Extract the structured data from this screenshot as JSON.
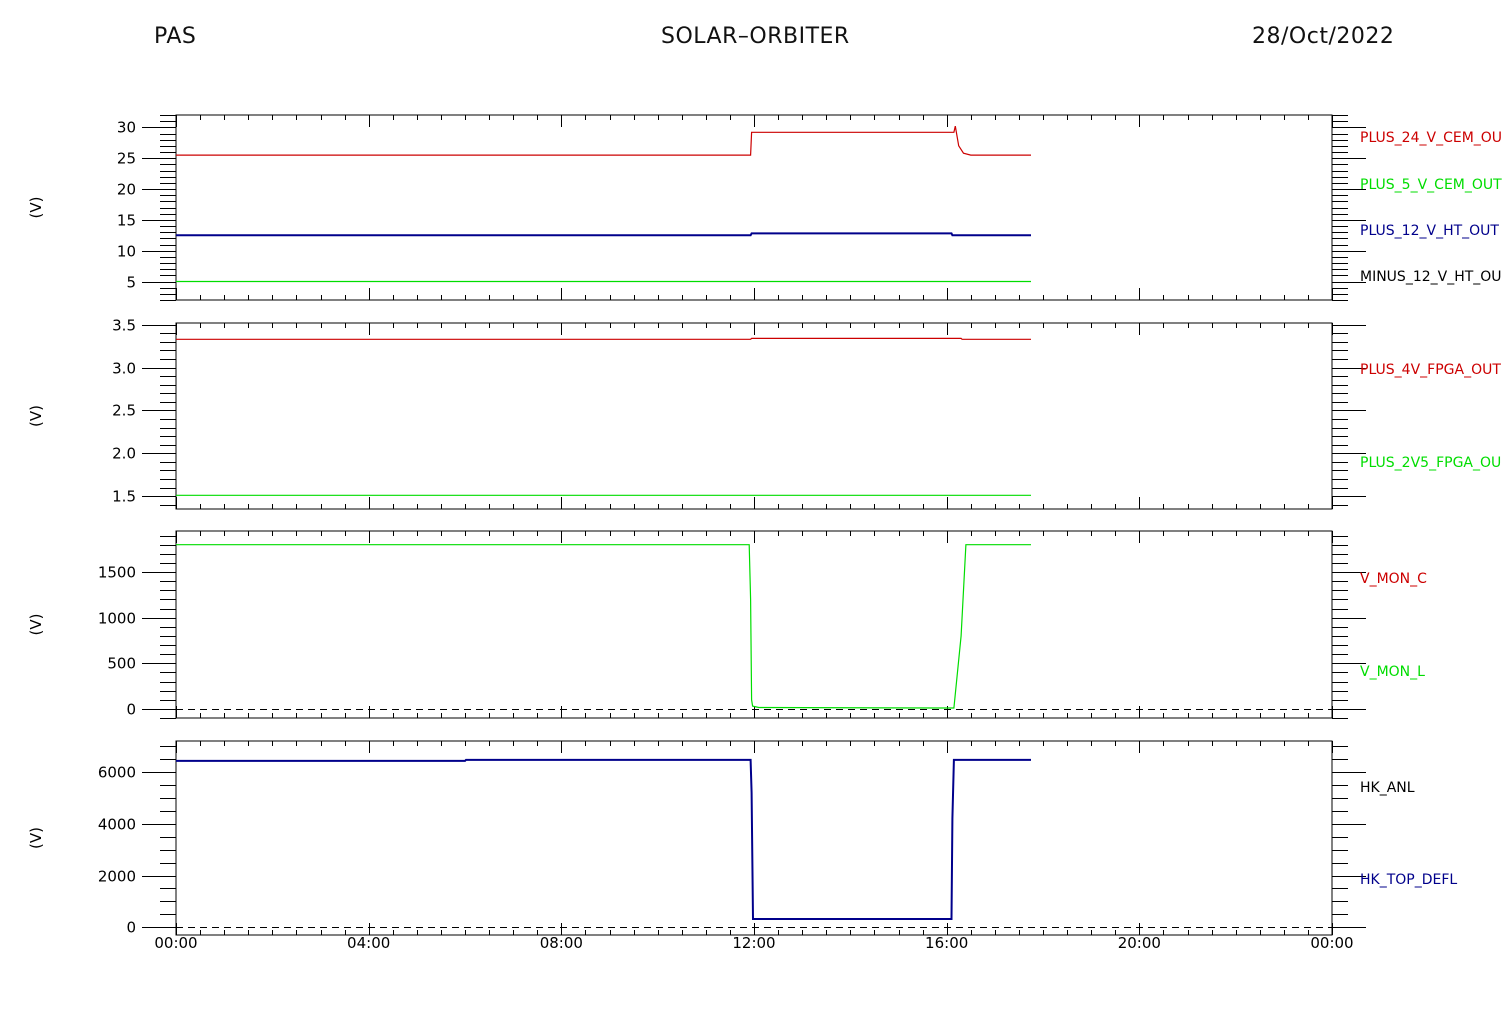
{
  "header": {
    "left": "PAS",
    "center": "SOLAR–ORBITER",
    "right": "28/Oct/2022"
  },
  "colors": {
    "red": "#cc0000",
    "green": "#00dd00",
    "blue": "#00008b",
    "black": "#000000",
    "axis": "#000000"
  },
  "chart_data": [
    {
      "type": "line",
      "ylabel": "(V)",
      "ylim": [
        2,
        32
      ],
      "yticks": [
        5,
        10,
        15,
        20,
        25,
        30
      ],
      "ytick_labels": [
        "5",
        "10",
        "15",
        "20",
        "25",
        "30"
      ],
      "minor_step": 1,
      "legend": "right",
      "series": [
        {
          "name": "PLUS_24_V_CEM_OU",
          "color": "#cc0000",
          "x": [
            0,
            11.93,
            11.95,
            16.15,
            16.18,
            16.25,
            16.35,
            16.5,
            17.75
          ],
          "y": [
            25.5,
            25.5,
            29.2,
            29.2,
            30.2,
            27.0,
            25.8,
            25.5,
            25.5
          ]
        },
        {
          "name": "PLUS_5_V_CEM_OUT",
          "color": "#00dd00",
          "x": [
            0,
            17.75
          ],
          "y": [
            5.0,
            5.0
          ]
        },
        {
          "name": "PLUS_12_V_HT_OUT",
          "color": "#00008b",
          "x": [
            0,
            11.93,
            11.95,
            16.1,
            16.12,
            17.75
          ],
          "y": [
            12.5,
            12.5,
            12.8,
            12.8,
            12.5,
            12.5
          ]
        },
        {
          "name": "MINUS_12_V_HT_OU",
          "color": "#000000",
          "x": [],
          "y": []
        }
      ]
    },
    {
      "type": "line",
      "ylabel": "(V)",
      "ylim": [
        1.35,
        3.52
      ],
      "yticks": [
        1.5,
        2.0,
        2.5,
        3.0,
        3.5
      ],
      "ytick_labels": [
        "1.5",
        "2.0",
        "2.5",
        "3.0",
        "3.5"
      ],
      "minor_step": 0.1,
      "legend": "right",
      "series": [
        {
          "name": "PLUS_4V_FPGA_OUT",
          "color": "#cc0000",
          "x": [
            0,
            11.93,
            11.95,
            16.3,
            16.32,
            17.75
          ],
          "y": [
            3.33,
            3.33,
            3.34,
            3.34,
            3.33,
            3.33
          ]
        },
        {
          "name": "PLUS_2V5_FPGA_OU",
          "color": "#00dd00",
          "x": [
            0,
            17.75
          ],
          "y": [
            1.51,
            1.51
          ]
        }
      ]
    },
    {
      "type": "line",
      "ylabel": "(V)",
      "ylim": [
        -100,
        1950
      ],
      "yticks": [
        0,
        500,
        1000,
        1500
      ],
      "ytick_labels": [
        "0",
        "500",
        "1000",
        "1500"
      ],
      "minor_step": 100,
      "zero_line": 0,
      "legend": "right",
      "series": [
        {
          "name": "V_MON_C",
          "color": "#cc0000",
          "x": [],
          "y": []
        },
        {
          "name": "V_MON_L",
          "color": "#00dd00",
          "x": [
            0,
            11.9,
            11.93,
            11.95,
            11.97,
            12.1,
            16.0,
            16.15,
            16.3,
            16.4,
            17.75
          ],
          "y": [
            1800,
            1800,
            1200,
            100,
            30,
            15,
            10,
            10,
            800,
            1800,
            1800
          ]
        }
      ]
    },
    {
      "type": "line",
      "ylabel": "(V)",
      "ylim": [
        -300,
        7200
      ],
      "yticks": [
        0,
        2000,
        4000,
        6000
      ],
      "ytick_labels": [
        "0",
        "2000",
        "4000",
        "6000"
      ],
      "minor_step": 500,
      "zero_line": 0,
      "legend": "right",
      "series": [
        {
          "name": "HK_ANL",
          "color": "#000000",
          "x": [],
          "y": []
        },
        {
          "name": "HK_TOP_DEFL",
          "color": "#00008b",
          "x": [
            0,
            6.0,
            6.02,
            11.93,
            11.95,
            11.98,
            16.1,
            16.12,
            16.15,
            16.2,
            17.75
          ],
          "y": [
            6430,
            6430,
            6470,
            6470,
            5200,
            320,
            320,
            4200,
            6470,
            6470,
            6470
          ]
        }
      ]
    }
  ],
  "xaxis": {
    "range": [
      0,
      24
    ],
    "ticks": [
      0,
      4,
      8,
      12,
      16,
      20,
      24
    ],
    "tick_labels": [
      "00:00",
      "04:00",
      "08:00",
      "12:00",
      "16:00",
      "20:00",
      "00:00"
    ],
    "minor_step": 0.5
  }
}
